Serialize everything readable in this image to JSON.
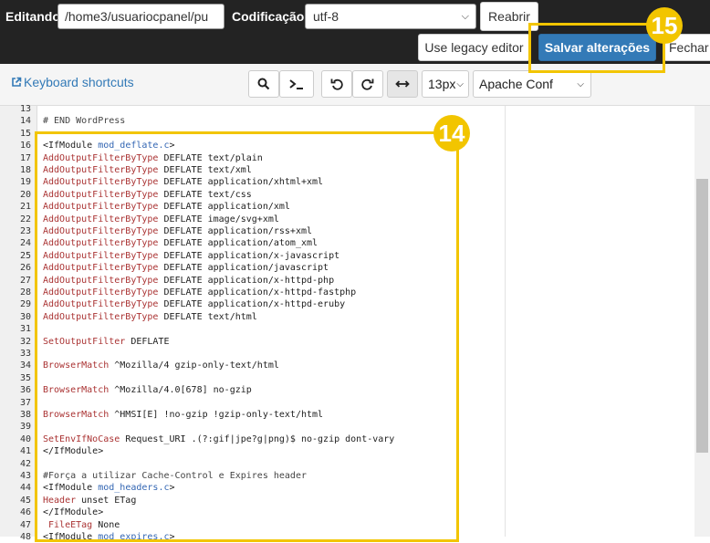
{
  "header": {
    "editing_label": "Editando:",
    "path_value": "/home3/usuariocpanel/pu",
    "encoding_label": "Codificação:",
    "encoding_value": "utf-8",
    "reopen_label": "Reabrir",
    "legacy_label": "Use legacy editor",
    "save_label": "Salvar alterações",
    "close_label": "Fechar"
  },
  "toolbar": {
    "keyboard_shortcuts": "Keyboard shortcuts",
    "font_size": "13px",
    "mode": "Apache Conf"
  },
  "annotations": {
    "badge_14": "14",
    "badge_15": "15"
  },
  "editor": {
    "line_numbers": [
      "13",
      "14",
      "15",
      "16",
      "17",
      "18",
      "19",
      "20",
      "21",
      "22",
      "23",
      "24",
      "25",
      "26",
      "27",
      "28",
      "29",
      "30",
      "31",
      "32",
      "33",
      "34",
      "35",
      "36",
      "37",
      "38",
      "39",
      "40",
      "41",
      "42",
      "43",
      "44",
      "45",
      "46",
      "47",
      "48"
    ],
    "lines": [
      {
        "k": "",
        "r": ""
      },
      {
        "k": "",
        "r": "# END WordPress"
      },
      {
        "k": "",
        "r": ""
      },
      {
        "k": "",
        "r": "<IfModule ",
        "n": "mod_deflate.c",
        "t": ">"
      },
      {
        "k": "AddOutputFilterByType",
        "r": " DEFLATE text/plain"
      },
      {
        "k": "AddOutputFilterByType",
        "r": " DEFLATE text/xml"
      },
      {
        "k": "AddOutputFilterByType",
        "r": " DEFLATE application/xhtml+xml"
      },
      {
        "k": "AddOutputFilterByType",
        "r": " DEFLATE text/css"
      },
      {
        "k": "AddOutputFilterByType",
        "r": " DEFLATE application/xml"
      },
      {
        "k": "AddOutputFilterByType",
        "r": " DEFLATE image/svg+xml"
      },
      {
        "k": "AddOutputFilterByType",
        "r": " DEFLATE application/rss+xml"
      },
      {
        "k": "AddOutputFilterByType",
        "r": " DEFLATE application/atom_xml"
      },
      {
        "k": "AddOutputFilterByType",
        "r": " DEFLATE application/x-javascript"
      },
      {
        "k": "AddOutputFilterByType",
        "r": " DEFLATE application/javascript"
      },
      {
        "k": "AddOutputFilterByType",
        "r": " DEFLATE application/x-httpd-php"
      },
      {
        "k": "AddOutputFilterByType",
        "r": " DEFLATE application/x-httpd-fastphp"
      },
      {
        "k": "AddOutputFilterByType",
        "r": " DEFLATE application/x-httpd-eruby"
      },
      {
        "k": "AddOutputFilterByType",
        "r": " DEFLATE text/html"
      },
      {
        "k": "",
        "r": ""
      },
      {
        "k": "SetOutputFilter",
        "r": " DEFLATE"
      },
      {
        "k": "",
        "r": ""
      },
      {
        "k": "BrowserMatch",
        "r": " ^Mozilla/4 gzip-only-text/html"
      },
      {
        "k": "",
        "r": ""
      },
      {
        "k": "BrowserMatch",
        "r": " ^Mozilla/4.0[678] no-gzip"
      },
      {
        "k": "",
        "r": ""
      },
      {
        "k": "BrowserMatch",
        "r": " ^HMSI[E] !no-gzip !gzip-only-text/html"
      },
      {
        "k": "",
        "r": ""
      },
      {
        "k": "SetEnvIfNoCase",
        "r": " Request_URI .(?:gif|jpe?g|png)$ no-gzip dont-vary"
      },
      {
        "k": "",
        "r": "</IfModule>"
      },
      {
        "k": "",
        "r": ""
      },
      {
        "k": "",
        "r": "#Força a utilizar Cache-Control e Expires header"
      },
      {
        "k": "",
        "r": "<IfModule ",
        "n": "mod_headers.c",
        "t": ">"
      },
      {
        "k": "Header",
        "r": " unset ETag"
      },
      {
        "k": "",
        "r": "</IfModule>"
      },
      {
        "k": " FileETag",
        "r": " None"
      },
      {
        "k": "",
        "r": "<IfModule ",
        "n": "mod_expires.c",
        "t": ">"
      }
    ]
  }
}
